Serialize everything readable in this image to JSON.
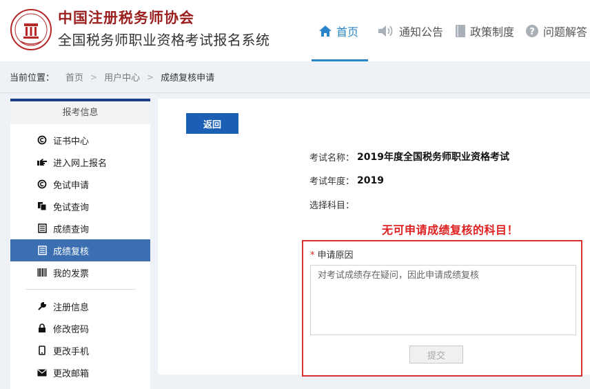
{
  "header": {
    "org_name": "中国注册税务师协会",
    "system_name": "全国税务师职业资格考试报名系统",
    "nav": [
      {
        "label": "首页",
        "icon": "home-icon"
      },
      {
        "label": "通知公告",
        "icon": "speaker-icon"
      },
      {
        "label": "政策制度",
        "icon": "document-icon"
      },
      {
        "label": "问题解答",
        "icon": "question-icon"
      }
    ],
    "accent_color": "#2b86c9"
  },
  "breadcrumb": {
    "label": "当前位置：",
    "items": [
      "首页",
      "用户中心",
      "成绩复核申请"
    ],
    "separator": ">"
  },
  "sidebar": {
    "heading": "报考信息",
    "items": [
      {
        "label": "证书中心",
        "icon": "certificate-icon"
      },
      {
        "label": "进入网上报名",
        "icon": "pointing-hand-icon"
      },
      {
        "label": "免试申请",
        "icon": "exempt-icon"
      },
      {
        "label": "免试查询",
        "icon": "files-icon"
      },
      {
        "label": "成绩查询",
        "icon": "list-icon"
      },
      {
        "label": "成绩复核",
        "icon": "list-icon"
      },
      {
        "label": "我的发票",
        "icon": "barcode-icon"
      },
      {
        "label": "注册信息",
        "icon": "wrench-icon"
      },
      {
        "label": "修改密码",
        "icon": "lock-icon"
      },
      {
        "label": "更改手机",
        "icon": "phone-icon"
      },
      {
        "label": "更改邮箱",
        "icon": "mail-icon"
      }
    ],
    "active_color": "#3c6fb2"
  },
  "main": {
    "back_label": "返回",
    "exam_name_label": "考试名称：",
    "exam_name": "2019年度全国税务师职业资格考试",
    "exam_year_label": "考试年度：",
    "exam_year": "2019",
    "subject_label": "选择科目：",
    "warning": "无可申请成绩复核的科目！",
    "reason_required_mark": "*",
    "reason_label": "申请原因",
    "reason_value": "对考试成绩存在疑问，因此申请成绩复核",
    "submit_label": "提交"
  }
}
